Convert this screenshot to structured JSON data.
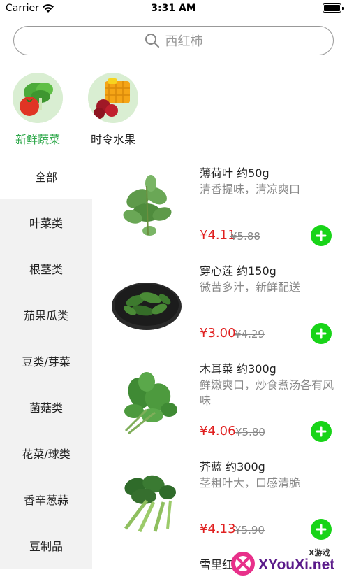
{
  "status_bar": {
    "carrier": "Carrier",
    "time": "3:31 AM",
    "battery_level": 1.0
  },
  "search": {
    "placeholder": "西红柿"
  },
  "top_categories": [
    {
      "label": "新鲜蔬菜",
      "active": true,
      "icon": "vegetables-icon"
    },
    {
      "label": "时令水果",
      "active": false,
      "icon": "fruits-icon"
    }
  ],
  "sidebar": {
    "items": [
      {
        "label": "全部",
        "selected": true
      },
      {
        "label": "叶菜类",
        "selected": false
      },
      {
        "label": "根茎类",
        "selected": false
      },
      {
        "label": "茄果瓜类",
        "selected": false
      },
      {
        "label": "豆类/芽菜",
        "selected": false
      },
      {
        "label": "菌菇类",
        "selected": false
      },
      {
        "label": "花菜/球类",
        "selected": false
      },
      {
        "label": "香辛葱蒜",
        "selected": false
      },
      {
        "label": "豆制品",
        "selected": false
      }
    ]
  },
  "products": [
    {
      "name": "薄荷叶 约50g",
      "desc": "清香提味，清凉爽口",
      "price": "¥4.11",
      "old_price": "¥5.88"
    },
    {
      "name": "穿心莲 约150g",
      "desc": "微苦多汁，新鲜配送",
      "price": "¥3.00",
      "old_price": "¥4.29"
    },
    {
      "name": "木耳菜 约300g",
      "desc": "鲜嫩爽口，炒食煮汤各有风味",
      "price": "¥4.06",
      "old_price": "¥5.80"
    },
    {
      "name": "芥蓝 约300g",
      "desc": "茎粗叶大，口感清脆",
      "price": "¥4.13",
      "old_price": "¥5.90"
    },
    {
      "name": "雪里红",
      "desc": "",
      "price": "",
      "old_price": ""
    }
  ],
  "watermark": {
    "main": "XYouXi.net",
    "small": "X游戏"
  },
  "colors": {
    "accent_green": "#2ea84a",
    "add_button": "#18d418",
    "price_red": "#e02020"
  }
}
